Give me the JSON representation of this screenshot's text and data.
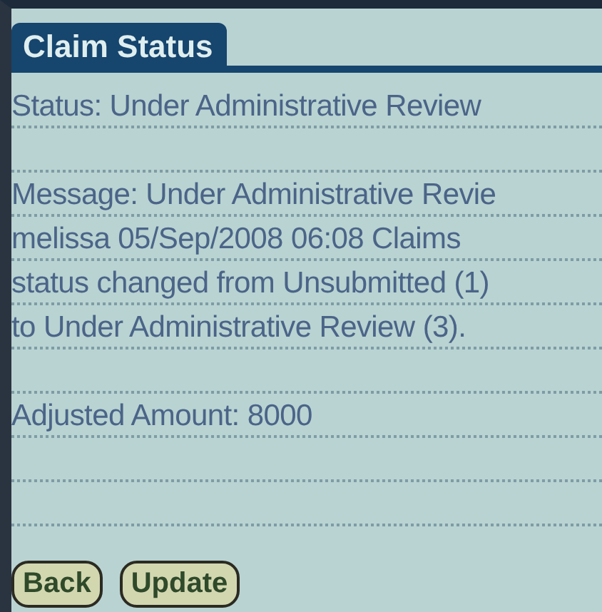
{
  "form": {
    "title": "Claim Status"
  },
  "lines": [
    {
      "kind": "text",
      "text": "Status: Under Administrative Review"
    },
    {
      "kind": "blank"
    },
    {
      "kind": "text",
      "text": "Message: Under Administrative Revie"
    },
    {
      "kind": "text",
      "text": "melissa 05/Sep/2008 06:08  Claims"
    },
    {
      "kind": "text",
      "text": "status changed from Unsubmitted (1)"
    },
    {
      "kind": "text",
      "text": "to Under Administrative Review (3)."
    },
    {
      "kind": "blank"
    },
    {
      "kind": "text",
      "text": "Adjusted Amount: 8000"
    },
    {
      "kind": "blank"
    },
    {
      "kind": "blank"
    }
  ],
  "buttons": [
    "Back",
    "Update"
  ]
}
